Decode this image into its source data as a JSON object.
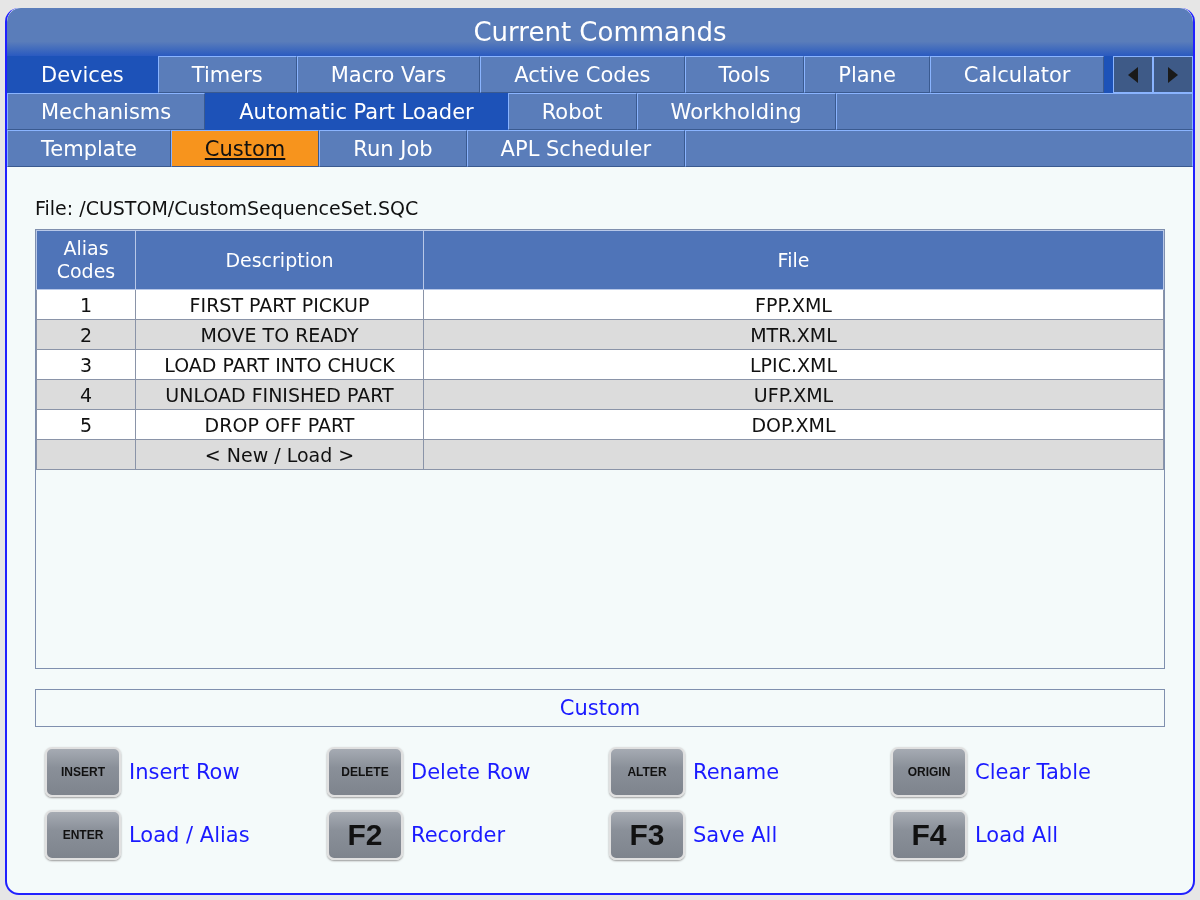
{
  "window": {
    "title": "Current Commands"
  },
  "tab_rows": [
    [
      {
        "label": "Devices",
        "selected": false,
        "open": true
      },
      {
        "label": "Timers",
        "selected": false,
        "open": false
      },
      {
        "label": "Macro Vars",
        "selected": false,
        "open": false
      },
      {
        "label": "Active Codes",
        "selected": false,
        "open": false
      },
      {
        "label": "Tools",
        "selected": false,
        "open": false
      },
      {
        "label": "Plane",
        "selected": false,
        "open": false
      },
      {
        "label": "Calculator",
        "selected": false,
        "open": false
      }
    ],
    [
      {
        "label": "Mechanisms",
        "selected": false,
        "open": false
      },
      {
        "label": "Automatic Part Loader",
        "selected": false,
        "open": true
      },
      {
        "label": "Robot",
        "selected": false,
        "open": false
      },
      {
        "label": "Workholding",
        "selected": false,
        "open": false
      }
    ],
    [
      {
        "label": "Template",
        "selected": false,
        "open": false
      },
      {
        "label": "Custom",
        "selected": true,
        "open": false
      },
      {
        "label": "Run Job",
        "selected": false,
        "open": false
      },
      {
        "label": "APL Scheduler",
        "selected": false,
        "open": false
      }
    ]
  ],
  "file_path": "File: /CUSTOM/CustomSequenceSet.SQC",
  "table": {
    "columns": [
      "Alias Codes",
      "Description",
      "File"
    ],
    "rows": [
      {
        "alias": "1",
        "description": "FIRST PART PICKUP",
        "file": "FPP.XML"
      },
      {
        "alias": "2",
        "description": "MOVE TO READY",
        "file": "MTR.XML"
      },
      {
        "alias": "3",
        "description": "LOAD PART INTO CHUCK",
        "file": "LPIC.XML"
      },
      {
        "alias": "4",
        "description": "UNLOAD FINISHED PART",
        "file": "UFP.XML"
      },
      {
        "alias": "5",
        "description": "DROP OFF PART",
        "file": "DOP.XML"
      },
      {
        "description": "< New / Load >"
      }
    ]
  },
  "mode_label": "Custom",
  "key_actions": [
    {
      "key": "INSERT",
      "kind": "word",
      "action": "Insert Row"
    },
    {
      "key": "DELETE",
      "kind": "word",
      "action": "Delete Row"
    },
    {
      "key": "ALTER",
      "kind": "word",
      "action": "Rename"
    },
    {
      "key": "ORIGIN",
      "kind": "word",
      "action": "Clear Table"
    },
    {
      "key": "ENTER",
      "kind": "word",
      "action": "Load / Alias"
    },
    {
      "key": "F2",
      "kind": "function",
      "action": "Recorder"
    },
    {
      "key": "F3",
      "kind": "function",
      "action": "Save All"
    },
    {
      "key": "F4",
      "kind": "function",
      "action": "Load All"
    }
  ]
}
